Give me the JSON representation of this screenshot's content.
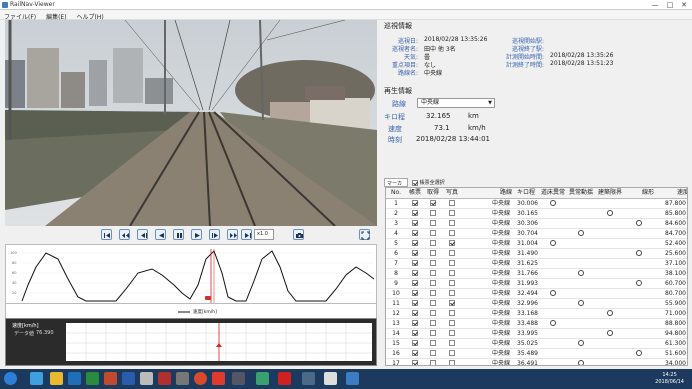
{
  "window": {
    "title": "RailNav-Viewer",
    "minimize": "—",
    "maximize": "□",
    "close": "✕"
  },
  "menu": [
    {
      "label": "ファイル(F)"
    },
    {
      "label": "編集(E)"
    },
    {
      "label": "ヘルプ(H)"
    }
  ],
  "video": {
    "zoom": "x1.0"
  },
  "graph": {
    "legend": "速度[km/h]"
  },
  "graph2": {
    "title": "速度[km/h]",
    "value_label": "データ値",
    "value": "76.390"
  },
  "survey": {
    "title": "巡視情報",
    "left": [
      {
        "label": "巡視日:",
        "value": "2018/02/28 13:35:26"
      },
      {
        "label": "巡視者名:",
        "value": "田中 他 3名"
      },
      {
        "label": "天気:",
        "value": "曇"
      },
      {
        "label": "重点項目:",
        "value": "なし"
      },
      {
        "label": "路線名:",
        "value": "中央線"
      }
    ],
    "right": [
      {
        "label": "巡視開始駅:",
        "value": ""
      },
      {
        "label": "巡視終了駅:",
        "value": ""
      },
      {
        "label": "計測開始時間:",
        "value": "2018/02/28 13:35:26"
      },
      {
        "label": "計測終了時間:",
        "value": "2018/02/28 13:51:23"
      }
    ]
  },
  "playback": {
    "title": "再生情報",
    "route_label": "路線",
    "route_value": "中央線",
    "km_label": "キロ程",
    "km_value": "32.165",
    "km_unit": "km",
    "speed_label": "速度",
    "speed_value": "73.1",
    "speed_unit": "km/h",
    "time_label": "時刻",
    "time_value": "2018/02/28 13:44:01"
  },
  "tabs": [
    {
      "label": "マーカーリスト"
    },
    {
      "label": "帳票全選択"
    }
  ],
  "table": {
    "headers": [
      "No.",
      "帳票",
      "取得",
      "写真",
      "路線",
      "キロ程",
      "道床異常",
      "異常動揺",
      "建築限界",
      "線形",
      "速度"
    ],
    "rows": [
      {
        "no": "1",
        "r": "中央線",
        "km": "30.006",
        "m": [
          1,
          0,
          0,
          0
        ],
        "speed": "87.800",
        "c": [
          1,
          1,
          0
        ]
      },
      {
        "no": "2",
        "r": "中央線",
        "km": "30.165",
        "m": [
          0,
          0,
          1,
          0
        ],
        "speed": "85.800",
        "c": [
          1,
          0,
          0
        ]
      },
      {
        "no": "3",
        "r": "中央線",
        "km": "30.306",
        "m": [
          0,
          0,
          0,
          1
        ],
        "speed": "84.600",
        "c": [
          1,
          0,
          0
        ]
      },
      {
        "no": "4",
        "r": "中央線",
        "km": "30.704",
        "m": [
          0,
          1,
          0,
          0
        ],
        "speed": "84.700",
        "c": [
          1,
          0,
          0
        ]
      },
      {
        "no": "5",
        "r": "中央線",
        "km": "31.004",
        "m": [
          1,
          0,
          0,
          0
        ],
        "speed": "52.400",
        "c": [
          1,
          0,
          1
        ]
      },
      {
        "no": "6",
        "r": "中央線",
        "km": "31.490",
        "m": [
          0,
          0,
          0,
          1
        ],
        "speed": "25.600",
        "c": [
          1,
          0,
          0
        ]
      },
      {
        "no": "7",
        "r": "中央線",
        "km": "31.625",
        "m": [
          0,
          0,
          0,
          0
        ],
        "speed": "37.100",
        "c": [
          1,
          0,
          0
        ]
      },
      {
        "no": "8",
        "r": "中央線",
        "km": "31.766",
        "m": [
          0,
          1,
          0,
          0
        ],
        "speed": "38.100",
        "c": [
          1,
          0,
          0
        ]
      },
      {
        "no": "9",
        "r": "中央線",
        "km": "31.993",
        "m": [
          0,
          0,
          0,
          1
        ],
        "speed": "60.700",
        "c": [
          1,
          0,
          0
        ]
      },
      {
        "no": "10",
        "r": "中央線",
        "km": "32.494",
        "m": [
          1,
          0,
          0,
          0
        ],
        "speed": "80.700",
        "c": [
          1,
          0,
          0
        ]
      },
      {
        "no": "11",
        "r": "中央線",
        "km": "32.996",
        "m": [
          0,
          1,
          0,
          0
        ],
        "speed": "55.900",
        "c": [
          1,
          0,
          1
        ]
      },
      {
        "no": "12",
        "r": "中央線",
        "km": "33.168",
        "m": [
          0,
          0,
          1,
          0
        ],
        "speed": "71.000",
        "c": [
          1,
          0,
          0
        ]
      },
      {
        "no": "13",
        "r": "中央線",
        "km": "33.488",
        "m": [
          1,
          0,
          0,
          0
        ],
        "speed": "88.800",
        "c": [
          1,
          0,
          0
        ]
      },
      {
        "no": "14",
        "r": "中央線",
        "km": "33.995",
        "m": [
          0,
          0,
          1,
          0
        ],
        "speed": "94.800",
        "c": [
          1,
          0,
          0
        ]
      },
      {
        "no": "15",
        "r": "中央線",
        "km": "35.025",
        "m": [
          0,
          1,
          0,
          0
        ],
        "speed": "61.300",
        "c": [
          1,
          0,
          0
        ]
      },
      {
        "no": "16",
        "r": "中央線",
        "km": "35.489",
        "m": [
          0,
          0,
          0,
          1
        ],
        "speed": "51.600",
        "c": [
          1,
          0,
          0
        ]
      },
      {
        "no": "17",
        "r": "中央線",
        "km": "36.491",
        "m": [
          0,
          1,
          0,
          0
        ],
        "speed": "34.000",
        "c": [
          1,
          0,
          0
        ]
      }
    ]
  },
  "taskbar": {
    "time": "14:25",
    "date": "2018/06/14"
  },
  "colors": {
    "accent": "#3a64b0",
    "taskbar": "#1c3a5e",
    "graph_line": "#111111",
    "cursor": "#e02020"
  }
}
